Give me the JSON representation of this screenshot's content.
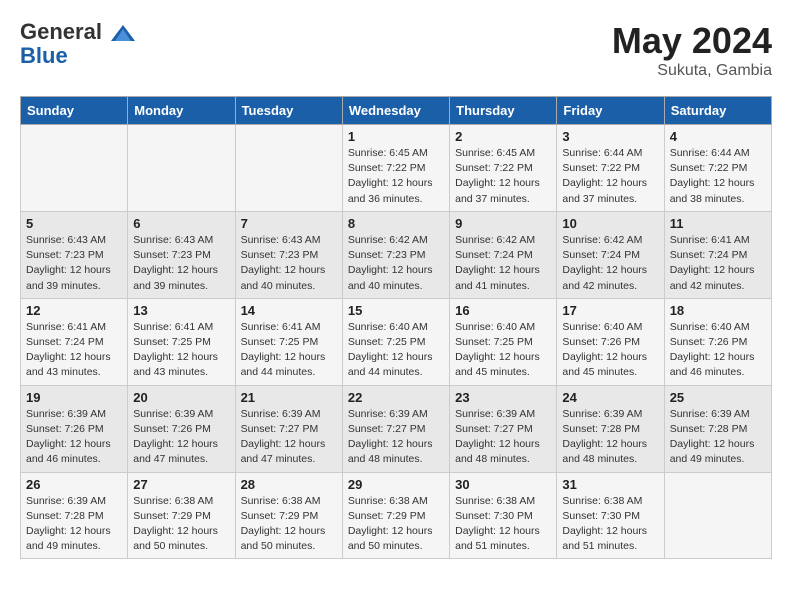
{
  "header": {
    "logo_line1": "General",
    "logo_line2": "Blue",
    "title": "May 2024",
    "subtitle": "Sukuta, Gambia"
  },
  "days_of_week": [
    "Sunday",
    "Monday",
    "Tuesday",
    "Wednesday",
    "Thursday",
    "Friday",
    "Saturday"
  ],
  "weeks": [
    [
      {
        "day": "",
        "info": ""
      },
      {
        "day": "",
        "info": ""
      },
      {
        "day": "",
        "info": ""
      },
      {
        "day": "1",
        "info": "Sunrise: 6:45 AM\nSunset: 7:22 PM\nDaylight: 12 hours\nand 36 minutes."
      },
      {
        "day": "2",
        "info": "Sunrise: 6:45 AM\nSunset: 7:22 PM\nDaylight: 12 hours\nand 37 minutes."
      },
      {
        "day": "3",
        "info": "Sunrise: 6:44 AM\nSunset: 7:22 PM\nDaylight: 12 hours\nand 37 minutes."
      },
      {
        "day": "4",
        "info": "Sunrise: 6:44 AM\nSunset: 7:22 PM\nDaylight: 12 hours\nand 38 minutes."
      }
    ],
    [
      {
        "day": "5",
        "info": "Sunrise: 6:43 AM\nSunset: 7:23 PM\nDaylight: 12 hours\nand 39 minutes."
      },
      {
        "day": "6",
        "info": "Sunrise: 6:43 AM\nSunset: 7:23 PM\nDaylight: 12 hours\nand 39 minutes."
      },
      {
        "day": "7",
        "info": "Sunrise: 6:43 AM\nSunset: 7:23 PM\nDaylight: 12 hours\nand 40 minutes."
      },
      {
        "day": "8",
        "info": "Sunrise: 6:42 AM\nSunset: 7:23 PM\nDaylight: 12 hours\nand 40 minutes."
      },
      {
        "day": "9",
        "info": "Sunrise: 6:42 AM\nSunset: 7:24 PM\nDaylight: 12 hours\nand 41 minutes."
      },
      {
        "day": "10",
        "info": "Sunrise: 6:42 AM\nSunset: 7:24 PM\nDaylight: 12 hours\nand 42 minutes."
      },
      {
        "day": "11",
        "info": "Sunrise: 6:41 AM\nSunset: 7:24 PM\nDaylight: 12 hours\nand 42 minutes."
      }
    ],
    [
      {
        "day": "12",
        "info": "Sunrise: 6:41 AM\nSunset: 7:24 PM\nDaylight: 12 hours\nand 43 minutes."
      },
      {
        "day": "13",
        "info": "Sunrise: 6:41 AM\nSunset: 7:25 PM\nDaylight: 12 hours\nand 43 minutes."
      },
      {
        "day": "14",
        "info": "Sunrise: 6:41 AM\nSunset: 7:25 PM\nDaylight: 12 hours\nand 44 minutes."
      },
      {
        "day": "15",
        "info": "Sunrise: 6:40 AM\nSunset: 7:25 PM\nDaylight: 12 hours\nand 44 minutes."
      },
      {
        "day": "16",
        "info": "Sunrise: 6:40 AM\nSunset: 7:25 PM\nDaylight: 12 hours\nand 45 minutes."
      },
      {
        "day": "17",
        "info": "Sunrise: 6:40 AM\nSunset: 7:26 PM\nDaylight: 12 hours\nand 45 minutes."
      },
      {
        "day": "18",
        "info": "Sunrise: 6:40 AM\nSunset: 7:26 PM\nDaylight: 12 hours\nand 46 minutes."
      }
    ],
    [
      {
        "day": "19",
        "info": "Sunrise: 6:39 AM\nSunset: 7:26 PM\nDaylight: 12 hours\nand 46 minutes."
      },
      {
        "day": "20",
        "info": "Sunrise: 6:39 AM\nSunset: 7:26 PM\nDaylight: 12 hours\nand 47 minutes."
      },
      {
        "day": "21",
        "info": "Sunrise: 6:39 AM\nSunset: 7:27 PM\nDaylight: 12 hours\nand 47 minutes."
      },
      {
        "day": "22",
        "info": "Sunrise: 6:39 AM\nSunset: 7:27 PM\nDaylight: 12 hours\nand 48 minutes."
      },
      {
        "day": "23",
        "info": "Sunrise: 6:39 AM\nSunset: 7:27 PM\nDaylight: 12 hours\nand 48 minutes."
      },
      {
        "day": "24",
        "info": "Sunrise: 6:39 AM\nSunset: 7:28 PM\nDaylight: 12 hours\nand 48 minutes."
      },
      {
        "day": "25",
        "info": "Sunrise: 6:39 AM\nSunset: 7:28 PM\nDaylight: 12 hours\nand 49 minutes."
      }
    ],
    [
      {
        "day": "26",
        "info": "Sunrise: 6:39 AM\nSunset: 7:28 PM\nDaylight: 12 hours\nand 49 minutes."
      },
      {
        "day": "27",
        "info": "Sunrise: 6:38 AM\nSunset: 7:29 PM\nDaylight: 12 hours\nand 50 minutes."
      },
      {
        "day": "28",
        "info": "Sunrise: 6:38 AM\nSunset: 7:29 PM\nDaylight: 12 hours\nand 50 minutes."
      },
      {
        "day": "29",
        "info": "Sunrise: 6:38 AM\nSunset: 7:29 PM\nDaylight: 12 hours\nand 50 minutes."
      },
      {
        "day": "30",
        "info": "Sunrise: 6:38 AM\nSunset: 7:30 PM\nDaylight: 12 hours\nand 51 minutes."
      },
      {
        "day": "31",
        "info": "Sunrise: 6:38 AM\nSunset: 7:30 PM\nDaylight: 12 hours\nand 51 minutes."
      },
      {
        "day": "",
        "info": ""
      }
    ]
  ]
}
